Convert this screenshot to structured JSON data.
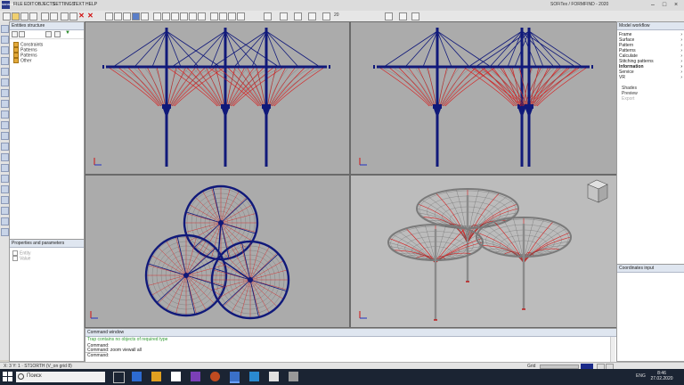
{
  "app": {
    "logo": "SOFiSTiK",
    "title": "SOFiTex / FORMFIND - 2020",
    "menu": [
      "FILE",
      "EDIT",
      "OBJECTS",
      "SETTINGS",
      "TEXT",
      "HELP"
    ]
  },
  "toolbar": {
    "zoom_value": "20"
  },
  "entities_panel": {
    "title": "Entities structure",
    "tree": [
      "Constraints",
      "Patterns",
      "Patterns",
      "Other"
    ]
  },
  "props_panel": {
    "title": "Properties and parameters",
    "rows": [
      "Entity",
      "Value"
    ]
  },
  "right_panel": {
    "title": "Model workflow",
    "items": [
      {
        "label": "Frame",
        "bold": false
      },
      {
        "label": "Surface",
        "bold": false
      },
      {
        "label": "Pattern",
        "bold": false
      },
      {
        "label": "Patterns",
        "bold": false
      },
      {
        "label": "Calculate",
        "bold": false
      },
      {
        "label": "Stitching patterns",
        "bold": false
      },
      {
        "label": "Information",
        "bold": true
      },
      {
        "label": "Service",
        "bold": false
      },
      {
        "label": "VR",
        "bold": false
      }
    ],
    "sub_items": [
      "Shades",
      "Preview",
      "Export"
    ]
  },
  "right_panel2": {
    "title": "Coordinates input"
  },
  "command": {
    "title": "Command window",
    "lines": [
      {
        "text": "Trap contains no objects of required type",
        "kind": "warn"
      },
      {
        "text": "Command:",
        "kind": "normal"
      },
      {
        "text": "Command: zoom viewall all",
        "kind": "normal"
      }
    ],
    "prompt": "Command:"
  },
  "status": {
    "left": "X: 3 Y: 1 · ST1ORTH (V_on grid 8)",
    "right": "Grid"
  },
  "taskbar": {
    "search_placeholder": "Поиск",
    "lang": "ENG",
    "time": "8:46",
    "date": "27.02.2020"
  },
  "colors": {
    "structure": "#10197a",
    "cables": "#d81a1a",
    "mesh": "#5a5a5a",
    "viewport": "#ababab"
  }
}
